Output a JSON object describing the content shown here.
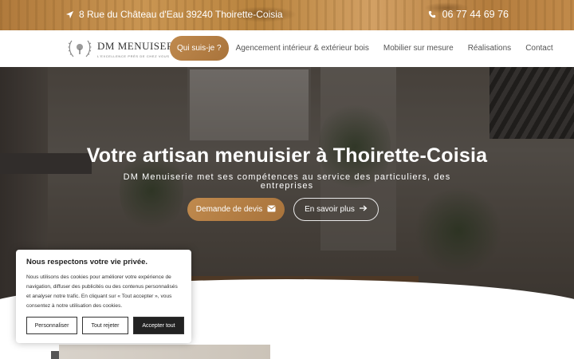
{
  "topbar": {
    "address": "8 Rue du Château d'Eau 39240 Thoirette-Coisia",
    "phone": "06 77 44 69 76"
  },
  "header": {
    "logo_title": "DM MENUISERIE",
    "logo_tagline": "L'EXCELLENCE PRÈS DE CHEZ VOUS",
    "nav": [
      {
        "label": "Qui suis-je ?",
        "active": true
      },
      {
        "label": "Agencement intérieur & extérieur bois",
        "active": false
      },
      {
        "label": "Mobilier sur mesure",
        "active": false
      },
      {
        "label": "Réalisations",
        "active": false
      },
      {
        "label": "Contact",
        "active": false
      }
    ]
  },
  "hero": {
    "title": "Votre artisan menuisier à Thoirette-Coisia",
    "subtitle": "DM Menuiserie met ses compétences au service des particuliers, des entreprises",
    "cta_primary": "Demande de devis",
    "cta_secondary": "En savoir plus"
  },
  "cookie": {
    "title": "Nous respectons votre vie privée.",
    "text": "Nous utilisons des cookies pour améliorer votre expérience de navigation, diffuser des publicités ou des contenus personnalisés et analyser notre trafic. En cliquant sur « Tout accepter », vous consentez à notre utilisation des cookies.",
    "btn_customize": "Personnaliser",
    "btn_reject": "Tout rejeter",
    "btn_accept": "Accepter tout"
  },
  "colors": {
    "accent": "#b07a3c",
    "nav_text": "#555555"
  },
  "icons": {
    "address": "location-arrow-icon",
    "phone": "phone-icon",
    "devis": "envelope-icon",
    "more": "arrow-right-icon"
  }
}
